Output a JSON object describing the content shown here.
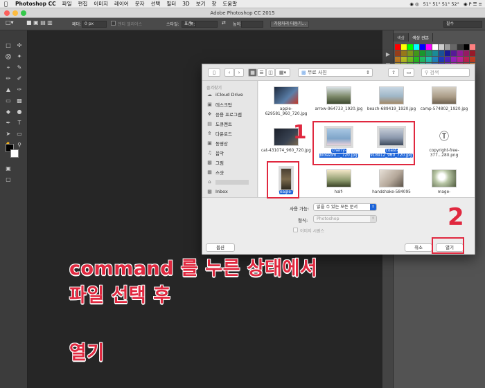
{
  "menubar": {
    "app": "Photoshop CC",
    "items": [
      "파일",
      "편집",
      "이미지",
      "레이어",
      "문자",
      "선택",
      "필터",
      "3D",
      "보기",
      "창",
      "도움말"
    ],
    "status": "51° 51° 51° 52°"
  },
  "window_title": "Adobe Photoshop CC 2015",
  "options_bar": {
    "feather_label": "페더:",
    "feather_value": "0 px",
    "antialias_label": "앤티 앨리어스",
    "style_label": "스타일:",
    "style_value": "표준",
    "width_label": "폭:",
    "height_label": "높이:",
    "refine_button": "가장자리 다듬기...",
    "workspace_value": "필수"
  },
  "panels": {
    "tabs": [
      "색상",
      "색상 견본"
    ]
  },
  "dialog": {
    "path_label": "무료 사진",
    "search_placeholder": "검색",
    "sidebar_header": "즐겨찾기",
    "sidebar": [
      {
        "icon": "cloud-icon",
        "label": "iCloud Drive"
      },
      {
        "icon": "desktop-icon",
        "label": "데스크탑"
      },
      {
        "icon": "applications-icon",
        "label": "응용 프로그램"
      },
      {
        "icon": "documents-icon",
        "label": "도큐멘트"
      },
      {
        "icon": "download-icon",
        "label": "다운로드"
      },
      {
        "icon": "movies-icon",
        "label": "동영상"
      },
      {
        "icon": "music-icon",
        "label": "음악"
      },
      {
        "icon": "pictures-icon",
        "label": "그림"
      },
      {
        "icon": "home-icon",
        "label": "스샷"
      },
      {
        "icon": "home-icon",
        "label": ""
      },
      {
        "icon": "folder-icon",
        "label": "Inbox"
      }
    ],
    "files": [
      {
        "name": "apple-629581_960_720.jpg",
        "selected": false,
        "color": "#5a7ea8"
      },
      {
        "name": "arrow-964733_1920.jpg",
        "selected": false,
        "color": "#7f8b6c"
      },
      {
        "name": "beach-689419_1920.jpg",
        "selected": false,
        "color": "#9fb6c7"
      },
      {
        "name": "camp-574802_1920.jpg",
        "selected": false,
        "color": "#a99a85"
      },
      {
        "name": "cat-431074_960_720.jpg",
        "selected": false,
        "color": "#384251"
      },
      {
        "name": "cherry-blossom..._720.jpg",
        "selected": true,
        "color": "#7fa5c9"
      },
      {
        "name": "coast-918912_960_720.jpg",
        "selected": true,
        "color": "#8c99ad"
      },
      {
        "name": "copyright-free-377...280.png",
        "selected": false,
        "color": "#ffffff"
      },
      {
        "name": "eagle-",
        "selected": true,
        "color": "#7b6a4d"
      },
      {
        "name": "half-",
        "selected": false,
        "color": "#8e9b6e"
      },
      {
        "name": "handshake-584095",
        "selected": false,
        "color": "#b5a89a"
      },
      {
        "name": "mage-",
        "selected": false,
        "color": "#b9c7a6"
      }
    ],
    "enable_label": "사용 가능:",
    "enable_value": "읽을 수 있는 모든 문서",
    "format_label": "형식:",
    "format_value": "Photoshop",
    "sequence_label": "이미지 시퀀스",
    "options_button": "옵션",
    "cancel_button": "취소",
    "open_button": "열기"
  },
  "annotations": {
    "num1": "1",
    "num2": "2",
    "caption_line1": "command 를  누른 상태에서",
    "caption_line2": "파일 선택 후",
    "caption_line3": "열기",
    "color": "#e0283f"
  }
}
